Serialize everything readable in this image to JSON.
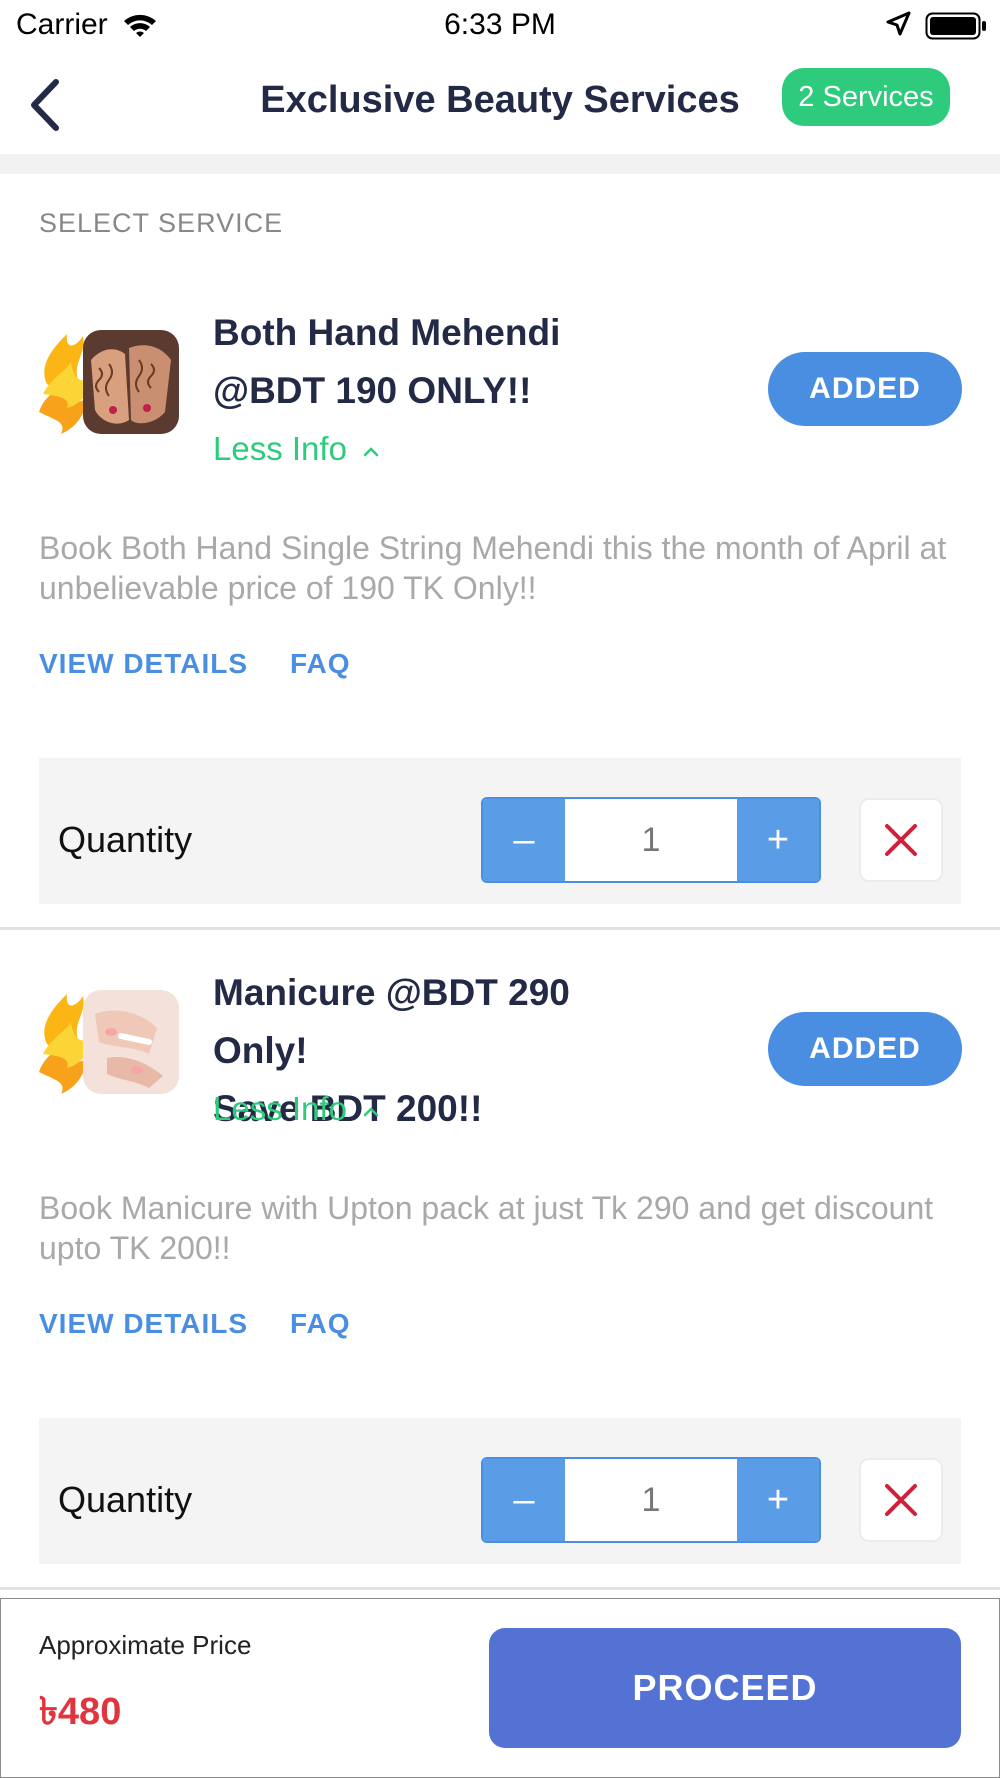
{
  "status_bar": {
    "carrier": "Carrier",
    "time": "6:33 PM"
  },
  "nav": {
    "title": "Exclusive Beauty Services",
    "badge": "2 Services"
  },
  "section_label": "SELECT SERVICE",
  "services": [
    {
      "title_line1": "Both Hand Mehendi",
      "title_line2": "@BDT 190 ONLY!!",
      "less_info": "Less Info",
      "button": "ADDED",
      "description": "Book Both Hand Single String  Mehendi this the month of April at unbelievable price of 190 TK Only!!",
      "view_details": "VIEW DETAILS",
      "faq": "FAQ",
      "quantity_label": "Quantity",
      "quantity": "1"
    },
    {
      "title_line1": "Manicure @BDT 290 Only!",
      "title_line2": "Save BDT 200!!",
      "less_info": "Less Info",
      "button": "ADDED",
      "description": "Book Manicure with Upton pack at just Tk 290 and get discount upto TK 200!!",
      "view_details": "VIEW DETAILS",
      "faq": "FAQ",
      "quantity_label": "Quantity",
      "quantity": "1"
    }
  ],
  "footer": {
    "approx_label": "Approximate Price",
    "price": "৳480",
    "proceed": "PROCEED"
  },
  "colors": {
    "accent_green": "#2ecb7c",
    "accent_blue": "#4a8ee2",
    "proceed_blue": "#5472d3",
    "price_red": "#e0343f",
    "remove_red": "#d0213a"
  },
  "icons": {
    "back": "chevron-left-icon",
    "wifi": "wifi-icon",
    "location": "location-arrow-icon",
    "battery": "battery-icon",
    "less_info": "chevron-up-icon",
    "remove": "close-icon"
  }
}
